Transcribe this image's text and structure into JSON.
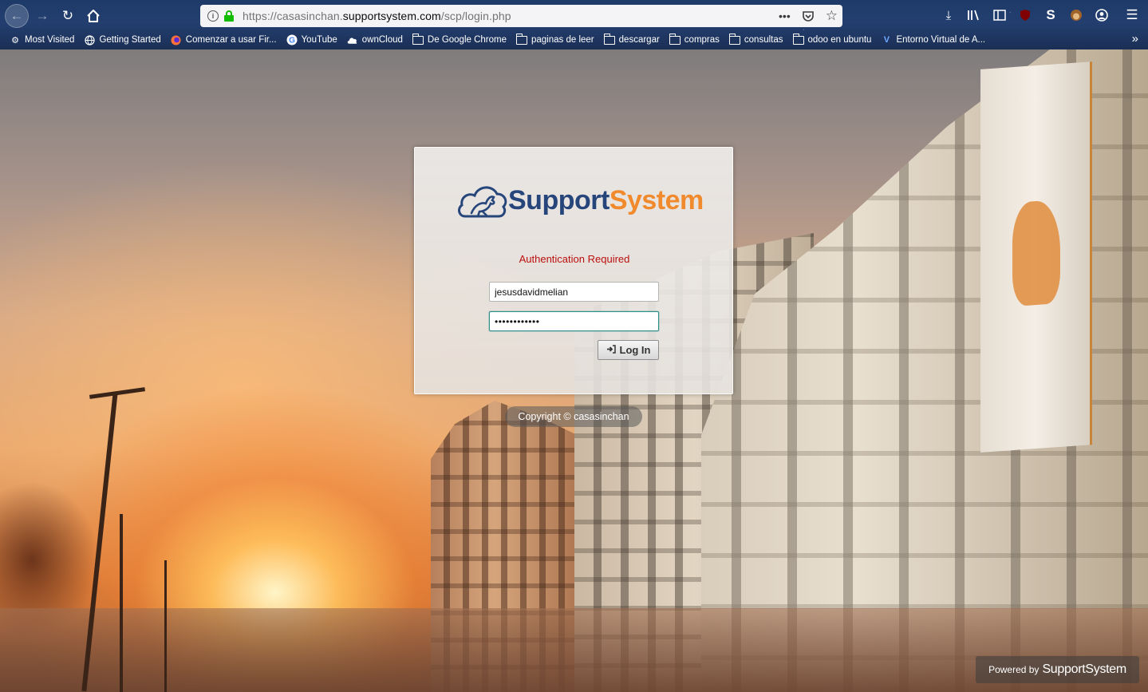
{
  "browser": {
    "url_prefix": "https://casasinchan.",
    "url_domain": "supportsystem.com",
    "url_path": "/scp/login.php",
    "page_actions_icon": "•••",
    "bookmarks": [
      {
        "label": "Most Visited",
        "icon": "gear-icon"
      },
      {
        "label": "Getting Started",
        "icon": "globe-icon"
      },
      {
        "label": "Comenzar a usar Fir...",
        "icon": "firefox-icon"
      },
      {
        "label": "YouTube",
        "icon": "google-icon"
      },
      {
        "label": "ownCloud",
        "icon": "cloud-icon"
      },
      {
        "label": "De Google Chrome",
        "icon": "folder-icon"
      },
      {
        "label": "paginas de leer",
        "icon": "folder-icon"
      },
      {
        "label": "descargar",
        "icon": "folder-icon"
      },
      {
        "label": "compras",
        "icon": "folder-icon"
      },
      {
        "label": "consultas",
        "icon": "folder-icon"
      },
      {
        "label": "odoo en ubuntu",
        "icon": "folder-icon"
      },
      {
        "label": "Entorno Virtual de A...",
        "icon": "moodle-icon"
      }
    ]
  },
  "login": {
    "logo_part1": "Support",
    "logo_part2": "System",
    "message": "Authentication Required",
    "username_value": "jesusdavidmelian",
    "password_value": "••••••••••••",
    "login_button_label": "Log In"
  },
  "footer": {
    "copyright": "Copyright © casasinchan",
    "powered_prefix": "Powered by",
    "powered_brand": "SupportSystem"
  },
  "colors": {
    "logo_blue": "#26467b",
    "logo_orange": "#f08a2c",
    "error_red": "#b90f0f"
  }
}
